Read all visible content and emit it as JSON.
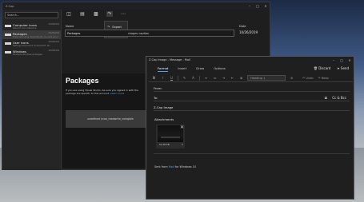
{
  "capture": {
    "title": "Z-Cap",
    "search_placeholder": "Search...",
    "items": [
      {
        "title": "Computer icons",
        "subtitle": "Generic icon reference",
        "date": "10/26/2019"
      },
      {
        "title": "Packages",
        "subtitle": "If you are using Visual Studio, be sure you signed in with",
        "date": "10/26/2019"
      },
      {
        "title": "User icons",
        "subtitle": "Settings Document, Screenshot, etc",
        "date": "10/26/2019"
      },
      {
        "title": "Windows",
        "subtitle": "Example Windows packages",
        "date": "10/26/2019"
      }
    ],
    "share_menu": [
      "Export",
      "E-mail"
    ],
    "name_label": "Name",
    "name_value": "Packages",
    "name_placeholder": "ckages caption",
    "date_label": "Date",
    "date_value": "10/26/2019",
    "preview": {
      "heading": "Packages",
      "text_before": "If you are using Visual Studio, be sure you signed in with the",
      "text_line2": "package are specific to this account.",
      "link": "Learn more",
      "code": "undefined (now_readwrite_nolegible"
    }
  },
  "mail": {
    "title": "Z-Cap Image - Message - Mail",
    "tabs": [
      "Format",
      "Insert",
      "Draw",
      "Options"
    ],
    "discard_label": "Discard",
    "send_label": "Send",
    "heading_select": "Heading 1",
    "undo_label": "Undo",
    "redo_label": "Redo",
    "from_label": "From:",
    "to_label": "To:",
    "cc_label": "Cc & Bcc",
    "subject": "Z-Cap Image",
    "attachments_label": "Attachments",
    "attachment_size": "51.58 KB",
    "signature_before": "Sent from",
    "signature_link": "Mail",
    "signature_after": "for Windows 10"
  }
}
